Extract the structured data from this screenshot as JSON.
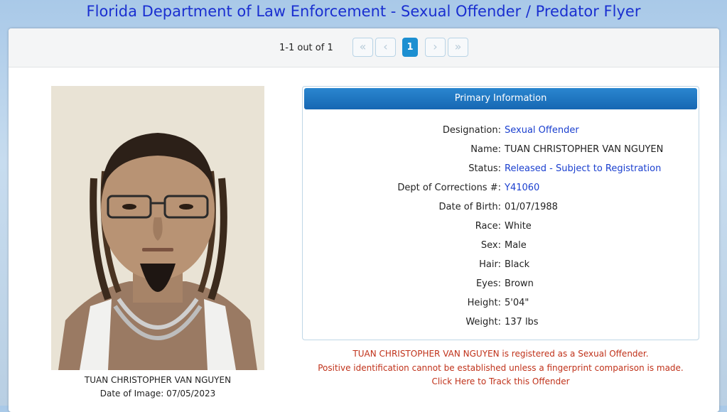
{
  "page": {
    "title": "Florida Department of Law Enforcement - Sexual Offender / Predator Flyer"
  },
  "pager": {
    "count_text": "1-1 out of 1",
    "first": "«",
    "prev": "‹",
    "current": "1",
    "next": "›",
    "last": "»"
  },
  "photo": {
    "name": "TUAN CHRISTOPHER VAN NGUYEN",
    "date": "Date of Image: 07/05/2023"
  },
  "primary": {
    "header": "Primary Information",
    "rows": [
      {
        "label": "Designation:",
        "value": "Sexual Offender",
        "link": true
      },
      {
        "label": "Name:",
        "value": "TUAN CHRISTOPHER VAN NGUYEN",
        "link": false
      },
      {
        "label": "Status:",
        "value": "Released - Subject to Registration",
        "link": true
      },
      {
        "label": "Dept of Corrections #:",
        "value": "Y41060",
        "link": true
      },
      {
        "label": "Date of Birth:",
        "value": "01/07/1988",
        "link": false
      },
      {
        "label": "Race:",
        "value": "White",
        "link": false
      },
      {
        "label": "Sex:",
        "value": "Male",
        "link": false
      },
      {
        "label": "Hair:",
        "value": "Black",
        "link": false
      },
      {
        "label": "Eyes:",
        "value": "Brown",
        "link": false
      },
      {
        "label": "Height:",
        "value": "5'04\"",
        "link": false
      },
      {
        "label": "Weight:",
        "value": "137 lbs",
        "link": false
      }
    ]
  },
  "notice": {
    "line1": "TUAN CHRISTOPHER VAN NGUYEN is registered as a Sexual Offender.",
    "line2": "Positive identification cannot be established unless a fingerprint comparison is made.",
    "track_link": "Click Here to Track this Offender"
  },
  "colors": {
    "title": "#1a2fd0",
    "header": "#1a74c0",
    "link": "#1a3fcf",
    "notice": "#c0321a"
  }
}
